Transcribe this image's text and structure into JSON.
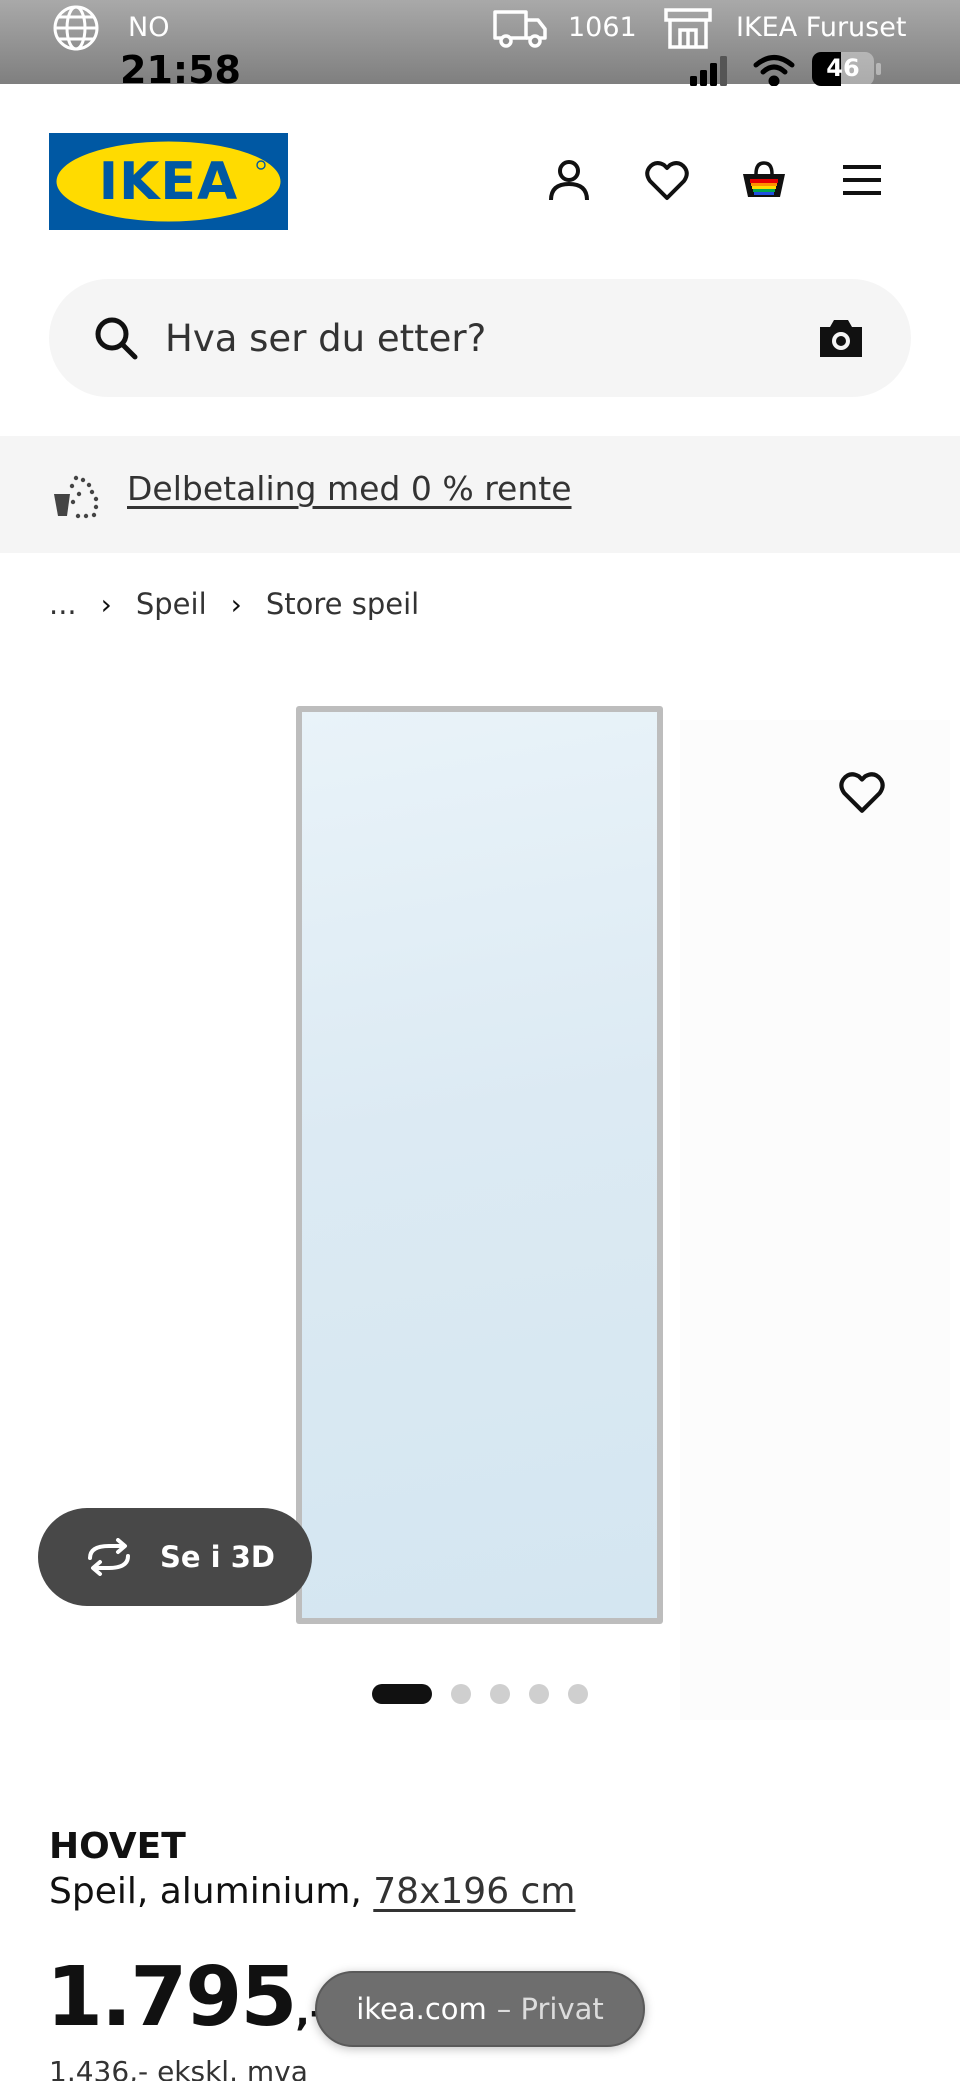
{
  "status_bar": {
    "country": "NO",
    "time": "21:58",
    "zip_code": "1061",
    "store": "IKEA Furuset",
    "battery_level": "46",
    "icons": [
      "globe-icon",
      "truck-icon",
      "store-icon",
      "signal-icon",
      "wifi-icon",
      "battery-icon"
    ]
  },
  "header": {
    "logo_text": "IKEA",
    "icons": [
      "account-icon",
      "favourites-icon",
      "cart-icon",
      "menu-icon"
    ]
  },
  "search": {
    "placeholder": "Hva ser du etter?",
    "icons": [
      "search-icon",
      "camera-icon"
    ]
  },
  "promo": {
    "text": "Delbetaling med 0 % rente",
    "icon": "payment-icon"
  },
  "breadcrumb": {
    "items": [
      "...",
      "Speil",
      "Store speil"
    ]
  },
  "gallery": {
    "see_3d_label": "Se i 3D",
    "image_count": 5,
    "active_index": 0
  },
  "product": {
    "name": "HOVET",
    "description": "Speil, aluminium, ",
    "size_link": "78x196 cm",
    "price": "1.795",
    "price_suffix": ",-",
    "price_ex_vat": "1.436,- ekskl. mva"
  },
  "browser": {
    "domain": "ikea.com",
    "mode": "– Privat"
  },
  "colors": {
    "ikea_blue": "#0058a3",
    "ikea_yellow": "#ffdb00",
    "text": "#111111",
    "gray_bg": "#f5f5f5"
  }
}
